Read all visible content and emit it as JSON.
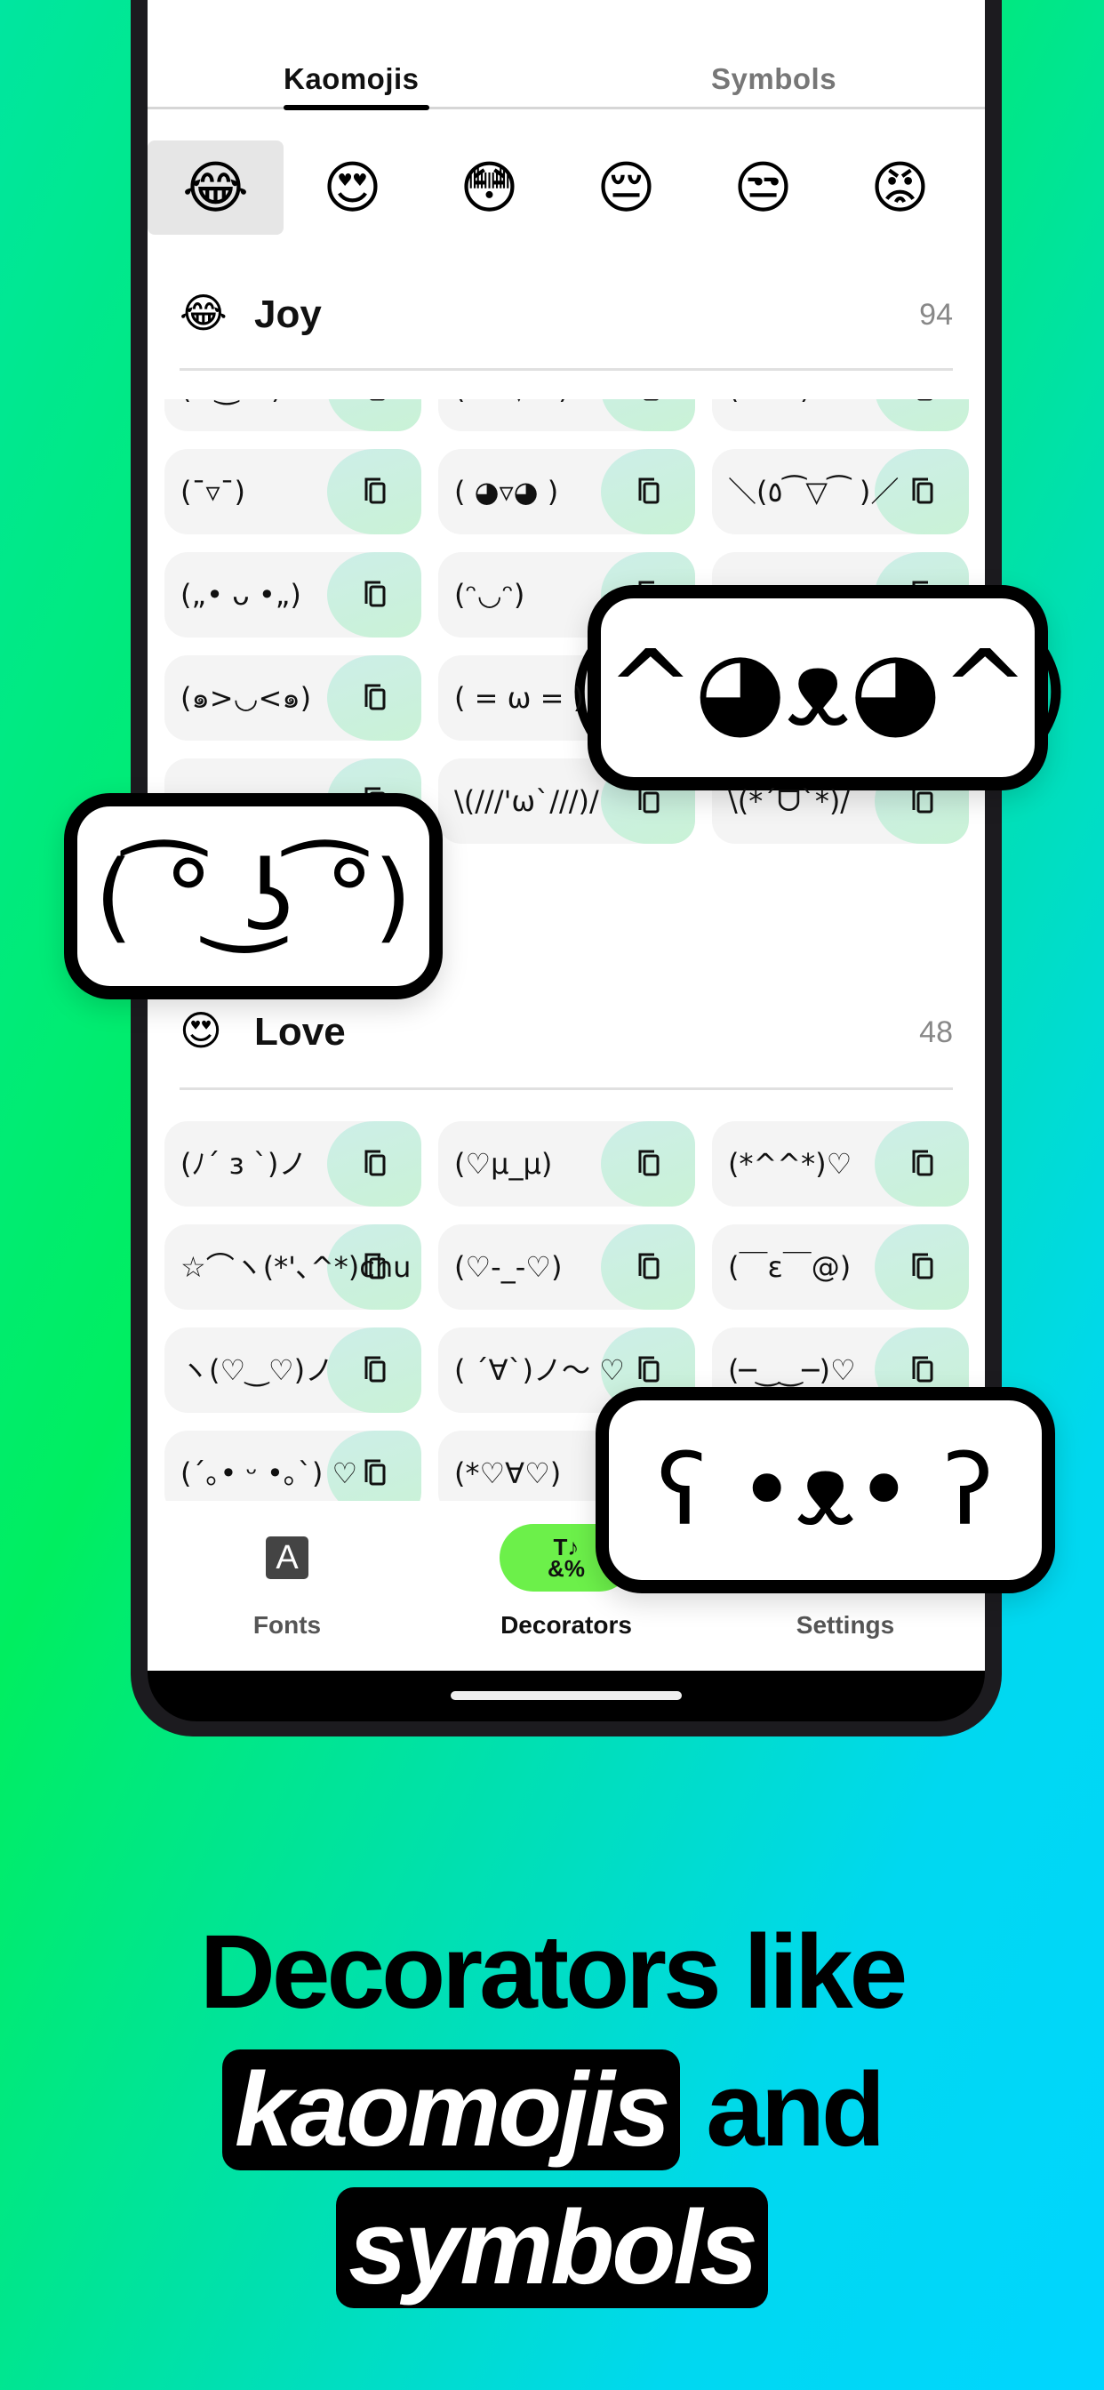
{
  "tabs": [
    {
      "label": "Kaomojis",
      "active": true
    },
    {
      "label": "Symbols",
      "active": false
    }
  ],
  "emoji_filters": [
    {
      "emoji": "😂",
      "selected": true
    },
    {
      "emoji": "😍"
    },
    {
      "emoji": "😳"
    },
    {
      "emoji": "😔"
    },
    {
      "emoji": "😒"
    },
    {
      "emoji": "😡"
    }
  ],
  "sections": [
    {
      "emoji": "😂",
      "title": "Joy",
      "count": "94",
      "items": [
        "(¬‿¬ )",
        "(*￣▽￣)b",
        "( ˙▿˙ )",
        "(¯▿¯)",
        "( ◕▿◕ )",
        "＼(٥⁀▽⁀ )／",
        "(„• ᴗ •„)",
        "(ᵔ◡ᵔ)",
        "",
        "(๑>◡<๑)",
        "( = ω = )",
        "",
        "",
        "\\(///'ω`///)/",
        "\\(*´ᗜ`*)/"
      ]
    },
    {
      "emoji": "😍",
      "title": "Love",
      "count": "48",
      "items": [
        "(ﾉ´ з `)ノ",
        "(♡μ_μ)",
        "(*^^*)♡",
        "☆⌒ヽ(*'､^*)chu",
        "(♡-_-♡)",
        "(￣ε￣@)",
        "ヽ(♡‿♡)ノ",
        "( ´∀`)ノ～ ♡",
        "(─‿‿─)♡",
        "(´｡• ᵕ •｡`) ♡",
        "(*♡∀♡)",
        ""
      ]
    }
  ],
  "nav": [
    {
      "label": "Fonts",
      "icon": "font-icon"
    },
    {
      "label": "Decorators",
      "icon": "decorators-icon",
      "active": true
    },
    {
      "label": "Settings",
      "icon": "settings-icon"
    }
  ],
  "nav_icon_glyphs": {
    "fonts": "A",
    "decorators_top": "T♪",
    "decorators_bottom": "&%"
  },
  "bubbles": [
    "(^◕ᴥ◕^)",
    "( ͡° ͜ʖ ͡°)",
    "ʕ •ᴥ• ʔ"
  ],
  "headline": {
    "line1": "Decorators like",
    "word1": "kaomojis",
    "and": "and",
    "word2": "symbols"
  },
  "colors": {
    "accent": "#6cf04a",
    "bg_left": "#00ee60",
    "bg_right": "#00d6ff"
  }
}
